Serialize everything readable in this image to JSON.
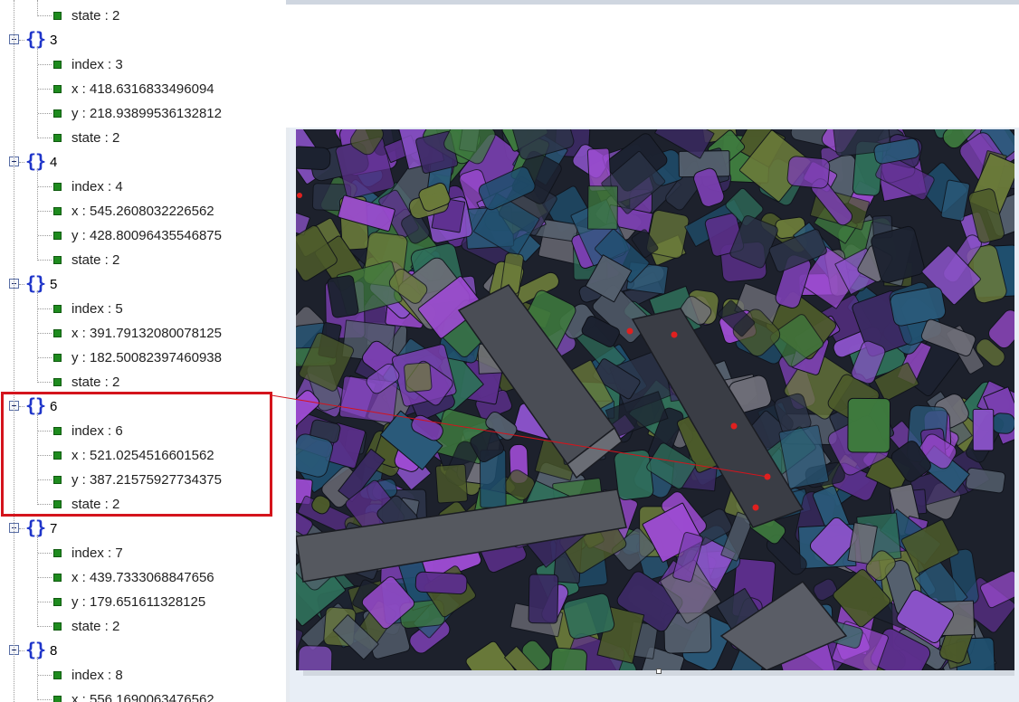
{
  "tree": {
    "rows": [
      {
        "kind": "prop",
        "text": "state : 2"
      },
      {
        "kind": "obj",
        "key": "3"
      },
      {
        "kind": "prop",
        "text": "index : 3"
      },
      {
        "kind": "prop",
        "text": "x : 418.6316833496094"
      },
      {
        "kind": "prop",
        "text": "y : 218.93899536132812"
      },
      {
        "kind": "prop",
        "text": "state : 2"
      },
      {
        "kind": "obj",
        "key": "4"
      },
      {
        "kind": "prop",
        "text": "index : 4"
      },
      {
        "kind": "prop",
        "text": "x : 545.2608032226562"
      },
      {
        "kind": "prop",
        "text": "y : 428.80096435546875"
      },
      {
        "kind": "prop",
        "text": "state : 2"
      },
      {
        "kind": "obj",
        "key": "5"
      },
      {
        "kind": "prop",
        "text": "index : 5"
      },
      {
        "kind": "prop",
        "text": "x : 391.79132080078125"
      },
      {
        "kind": "prop",
        "text": "y : 182.50082397460938"
      },
      {
        "kind": "prop",
        "text": "state : 2"
      },
      {
        "kind": "obj",
        "key": "6"
      },
      {
        "kind": "prop",
        "text": "index : 6"
      },
      {
        "kind": "prop",
        "text": "x : 521.0254516601562"
      },
      {
        "kind": "prop",
        "text": "y : 387.21575927734375"
      },
      {
        "kind": "prop",
        "text": "state : 2"
      },
      {
        "kind": "obj",
        "key": "7"
      },
      {
        "kind": "prop",
        "text": "index : 7"
      },
      {
        "kind": "prop",
        "text": "x : 439.7333068847656"
      },
      {
        "kind": "prop",
        "text": "y : 179.651611328125"
      },
      {
        "kind": "prop",
        "text": "state : 2"
      },
      {
        "kind": "obj",
        "key": "8"
      },
      {
        "kind": "prop",
        "text": "index : 8"
      },
      {
        "kind": "prop",
        "text": "x : 556.1690063476562"
      }
    ]
  },
  "viewer": {
    "image_description": "3D rendered pile of textured cubes and boxes",
    "highlight_color": "#d4141c",
    "marker_color": "#e0201f"
  }
}
